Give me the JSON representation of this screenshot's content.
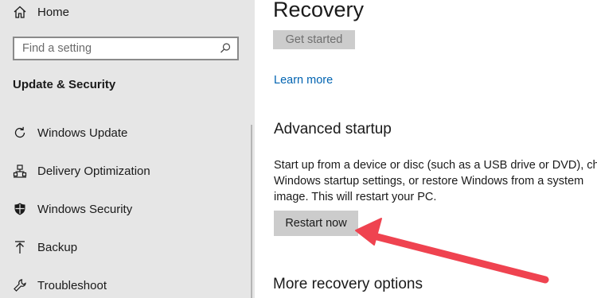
{
  "sidebar": {
    "home_label": "Home",
    "search": {
      "placeholder": "Find a setting",
      "value": ""
    },
    "section_title": "Update & Security",
    "items": [
      {
        "label": "Windows Update",
        "icon": "refresh-icon"
      },
      {
        "label": "Delivery Optimization",
        "icon": "delivery-optimization-icon"
      },
      {
        "label": "Windows Security",
        "icon": "shield-icon"
      },
      {
        "label": "Backup",
        "icon": "backup-arrow-icon"
      },
      {
        "label": "Troubleshoot",
        "icon": "wrench-icon"
      }
    ]
  },
  "main": {
    "title": "Recovery",
    "get_started_label": "Get started",
    "learn_more_label": "Learn more",
    "advanced": {
      "title": "Advanced startup",
      "description_lines": [
        "Start up from a device or disc (such as a USB drive or DVD), ch",
        "Windows startup settings, or restore Windows from a system",
        "image. This will restart your PC."
      ],
      "restart_label": "Restart now"
    },
    "more_options_title": "More recovery options"
  },
  "colors": {
    "sidebar_bg": "#e6e6e6",
    "button_bg": "#cccccc",
    "link": "#0063b1",
    "annotation_arrow": "#ef4350"
  }
}
